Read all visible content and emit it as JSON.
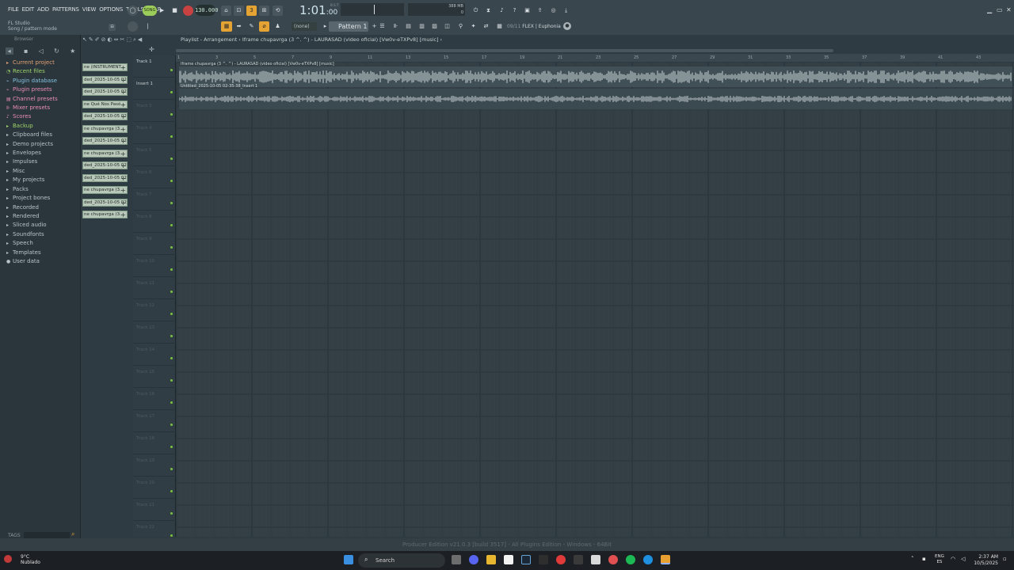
{
  "menu": [
    "FILE",
    "EDIT",
    "ADD",
    "PATTERNS",
    "VIEW",
    "OPTIONS",
    "TOOLS",
    "HELP"
  ],
  "transport": {
    "mode_label": "SONG",
    "tempo": "130.000",
    "time_main": "1:01",
    "time_sub": ":00",
    "time_label": "B:S:T"
  },
  "memory": {
    "label": "388 MB",
    "value": "0"
  },
  "hint": {
    "line1": "FL Studio",
    "line2": "Song / pattern mode"
  },
  "pattern_select": {
    "none_label": "(none)",
    "pattern_label": "Pattern 1"
  },
  "flex": {
    "index": "09/11",
    "name": "FLEX | Euphonia"
  },
  "browser": {
    "title": "Browser",
    "items": [
      {
        "icon": "folder-icon",
        "label": "Current project",
        "color": "#e39f73"
      },
      {
        "icon": "clock-icon",
        "label": "Recent files",
        "color": "#9dd36a"
      },
      {
        "icon": "plug-icon",
        "label": "Plugin database",
        "color": "#86c0de"
      },
      {
        "icon": "plug-icon",
        "label": "Plugin presets",
        "color": "#e98db3"
      },
      {
        "icon": "channel-icon",
        "label": "Channel presets",
        "color": "#e98db3"
      },
      {
        "icon": "mixer-icon",
        "label": "Mixer presets",
        "color": "#e98db3"
      },
      {
        "icon": "note-icon",
        "label": "Scores",
        "color": "#e98db3"
      },
      {
        "icon": "folder-icon",
        "label": "Backup",
        "color": "#9dd36a"
      },
      {
        "icon": "folder-icon",
        "label": "Clipboard files",
        "color": "#b8c3c7"
      },
      {
        "icon": "folder-icon",
        "label": "Demo projects",
        "color": "#b8c3c7"
      },
      {
        "icon": "folder-icon",
        "label": "Envelopes",
        "color": "#b8c3c7"
      },
      {
        "icon": "folder-icon",
        "label": "Impulses",
        "color": "#b8c3c7"
      },
      {
        "icon": "folder-icon",
        "label": "Misc",
        "color": "#b8c3c7"
      },
      {
        "icon": "folder-icon",
        "label": "My projects",
        "color": "#b8c3c7"
      },
      {
        "icon": "folder-icon",
        "label": "Packs",
        "color": "#b8c3c7"
      },
      {
        "icon": "folder-icon",
        "label": "Project bones",
        "color": "#b8c3c7"
      },
      {
        "icon": "folder-icon",
        "label": "Recorded",
        "color": "#b8c3c7"
      },
      {
        "icon": "folder-icon",
        "label": "Rendered",
        "color": "#b8c3c7"
      },
      {
        "icon": "folder-icon",
        "label": "Sliced audio",
        "color": "#b8c3c7"
      },
      {
        "icon": "folder-icon",
        "label": "Soundfonts",
        "color": "#b8c3c7"
      },
      {
        "icon": "folder-icon",
        "label": "Speech",
        "color": "#b8c3c7"
      },
      {
        "icon": "folder-icon",
        "label": "Templates",
        "color": "#b8c3c7"
      },
      {
        "icon": "user-icon",
        "label": "User data",
        "color": "#b8c3c7"
      }
    ],
    "tags_label": "TAGS"
  },
  "clips": [
    "ne (INSTRUMENT...",
    "ded_2025-10-05 02-...",
    "ded_2025-10-05 02-...",
    "ne Qué Nos Pasó...",
    "ded_2025-10-05 02-...",
    "ne chupavrga (3...",
    "ded_2025-10-05 02-...",
    "ne chupavrga (3...",
    "ded_2025-10-05 02-...",
    "ded_2025-10-05 02-...",
    "ne chupavrga (3...",
    "ded_2025-10-05 02-...",
    "ne chupavrga (3..."
  ],
  "playlist": {
    "title": "Playlist - Arrangement › Iframe chupavrga (3 ^. ^) - LAURASAD (video oficial) [Vw0v-eTXPv8] [music] ›",
    "ruler": [
      "1",
      "3",
      "5",
      "7",
      "9",
      "11",
      "13",
      "15",
      "17",
      "19",
      "21",
      "23",
      "25",
      "27",
      "29",
      "31",
      "33",
      "35",
      "37",
      "39",
      "41",
      "43"
    ],
    "tracks": [
      {
        "label": "Track 1",
        "active": true
      },
      {
        "label": "Insert 1",
        "active": true
      },
      {
        "label": "Track 3",
        "active": false
      },
      {
        "label": "Track 4",
        "active": false
      },
      {
        "label": "Track 5",
        "active": false
      },
      {
        "label": "Track 6",
        "active": false
      },
      {
        "label": "Track 7",
        "active": false
      },
      {
        "label": "Track 8",
        "active": false
      },
      {
        "label": "Track 9",
        "active": false
      },
      {
        "label": "Track 10",
        "active": false
      },
      {
        "label": "Track 11",
        "active": false
      },
      {
        "label": "Track 12",
        "active": false
      },
      {
        "label": "Track 13",
        "active": false
      },
      {
        "label": "Track 14",
        "active": false
      },
      {
        "label": "Track 15",
        "active": false
      },
      {
        "label": "Track 16",
        "active": false
      },
      {
        "label": "Track 17",
        "active": false
      },
      {
        "label": "Track 18",
        "active": false
      },
      {
        "label": "Track 19",
        "active": false
      },
      {
        "label": "Track 20",
        "active": false
      },
      {
        "label": "Track 21",
        "active": false
      },
      {
        "label": "Track 22",
        "active": false
      }
    ],
    "audio_clips": [
      {
        "label": "Iframe chupavrga (3 ^. ^) - LAURASAD (video oficial) [Vw0v-eTXPv8] [music]"
      },
      {
        "label": "Untitled_2025-10-05 02-35-38_Insert 1"
      }
    ]
  },
  "status_text": "Producer Edition v21.0.3 [build 3517] - All Plugins Edition - Windows - 64Bit",
  "taskbar": {
    "weather_temp": "9°C",
    "weather_desc": "Nublado",
    "search_label": "Search",
    "lang_line1": "ENG",
    "lang_line2": "ES",
    "time": "2:37 AM",
    "date": "10/5/2025"
  }
}
